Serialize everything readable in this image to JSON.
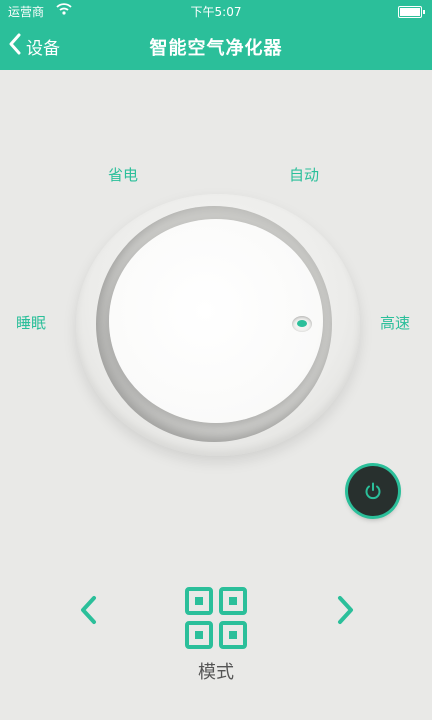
{
  "status_bar": {
    "carrier": "运营商",
    "time": "下午5:07"
  },
  "nav": {
    "back_label": "设备",
    "title": "智能空气净化器"
  },
  "modes": {
    "sleep": "睡眠",
    "save": "省电",
    "auto": "自动",
    "high": "高速"
  },
  "bottom": {
    "mode_label": "模式"
  },
  "colors": {
    "accent": "#2bbf9a",
    "background": "#e9e9e7",
    "power_bg": "#28302e"
  },
  "icons": {
    "back": "chevron-left-icon",
    "power": "power-icon",
    "prev": "chevron-left-icon",
    "next": "chevron-right-icon",
    "mode": "grid-icon",
    "wifi": "wifi-icon",
    "battery": "battery-icon"
  }
}
